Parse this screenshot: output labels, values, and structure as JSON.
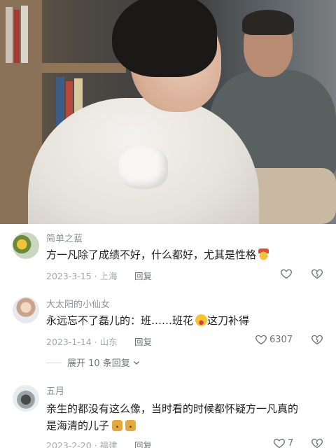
{
  "comments": [
    {
      "username": "简单之蓝",
      "text": "方一凡除了成绩不好，什么都好，尤其是性格",
      "emoji": "medal-emoji",
      "date_location": "2023-3-15 · 上海",
      "reply_label": "回复",
      "likes": ""
    },
    {
      "username": "大太阳的小仙女",
      "text_before": "永远忘不了磊儿的：班……班花",
      "text_after": "这刀补得",
      "emoji": "laughing-crying-emoji",
      "date_location": "2023-1-14 · 山东",
      "reply_label": "回复",
      "likes": "6307",
      "expand_label": "展开 10 条回复"
    },
    {
      "username": "五月",
      "text_line1": "亲生的都没有这么像，当时看的时候都怀疑方一凡真的",
      "text_line2": "是海清的儿子",
      "emoji": "cat-emoji",
      "date_location": "2023-2-20 · 福建",
      "reply_label": "回复",
      "likes": "7"
    }
  ],
  "colors": {
    "username": "#8a8f99",
    "meta": "#a3a7ae",
    "text": "#1f1f1f"
  }
}
